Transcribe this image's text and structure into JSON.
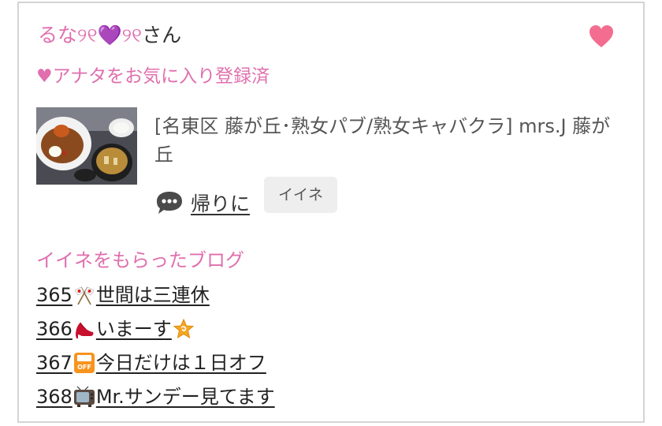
{
  "user": {
    "nickname": "るな୨୧💜୨୧",
    "suffix": "さん"
  },
  "favorite_status": "♥アナタをお気に入り登録済",
  "post": {
    "shop_info": "[名東区 藤が丘･熟女パブ/熟女キャバクラ]  mrs.J 藤が丘",
    "link_text": "帰りに",
    "like_label": "イイネ"
  },
  "liked_blogs": {
    "heading": "イイネをもらったブログ",
    "items": [
      {
        "number": "365",
        "icon": "crossed-flags-emoji",
        "title": "世間は三連休"
      },
      {
        "number": "366",
        "icon": "high-heel-emoji",
        "title": "いまーす",
        "trailing_icon": "dizzy-star-emoji"
      },
      {
        "number": "367",
        "icon": "off-sign-emoji",
        "title": "今日だけは１日オフ"
      },
      {
        "number": "368",
        "icon": "television-emoji",
        "title": "Mr.サンデー見てます"
      }
    ]
  },
  "colors": {
    "accent_pink": "#e06fae",
    "heart": "#f26d8f",
    "button_bg": "#eeeeee",
    "border": "#d4d4d4"
  }
}
